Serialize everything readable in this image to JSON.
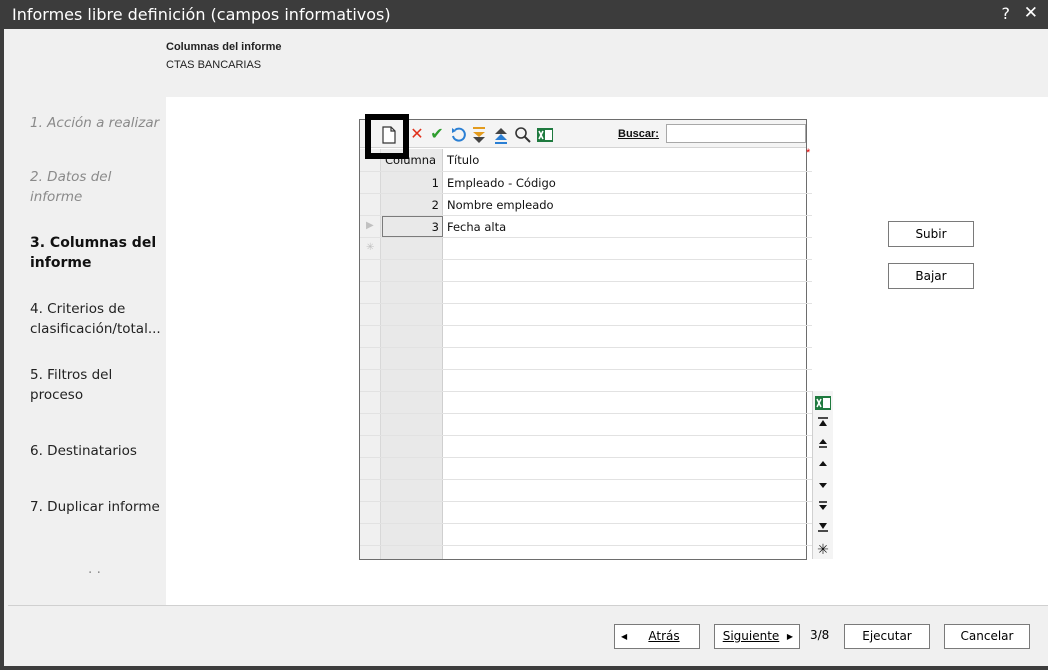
{
  "window": {
    "title": "Informes libre definición (campos informativos)",
    "help": "?",
    "close": "✕"
  },
  "header": {
    "title": "Columnas del informe",
    "subtitle": "CTAS BANCARIAS"
  },
  "sidebar": {
    "steps": [
      {
        "label": "1. Acción a realizar",
        "state": "done"
      },
      {
        "label": "2. Datos del informe",
        "state": "done"
      },
      {
        "label": "3. Columnas del informe",
        "state": "active"
      },
      {
        "label": "4. Criterios de clasificación/total...",
        "state": "pending"
      },
      {
        "label": "5. Filtros del proceso",
        "state": "pending"
      },
      {
        "label": "6. Destinatarios",
        "state": "pending"
      },
      {
        "label": "7. Duplicar informe",
        "state": "pending"
      },
      {
        "label": "· ·",
        "state": "pending"
      }
    ]
  },
  "toolbar": {
    "icons": [
      "new-icon",
      "delete-icon",
      "accept-icon",
      "undo-icon",
      "move-down-icon",
      "move-up-icon",
      "search-icon",
      "excel-icon"
    ],
    "search_label": "Buscar:",
    "search_value": ""
  },
  "grid": {
    "headers": {
      "column": "Columna",
      "title": "Título"
    },
    "required_mark": "*",
    "rows": [
      {
        "num": "1",
        "title": "Empleado -  Código"
      },
      {
        "num": "2",
        "title": "Nombre empleado"
      },
      {
        "num": "3",
        "title": "Fecha alta"
      }
    ],
    "current_marker": "▶",
    "new_marker": "✳"
  },
  "side_buttons": {
    "up": "Subir",
    "down": "Bajar"
  },
  "nav": {
    "excel": "X",
    "first": "⏫",
    "prev_page": "⏶",
    "prev": "▲",
    "next": "▼",
    "next_page": "⏷",
    "last": "⏬",
    "new": "✳"
  },
  "footer": {
    "back": "Atrás",
    "next": "Siguiente",
    "step_count": "3/8",
    "run": "Ejecutar",
    "cancel": "Cancelar"
  },
  "colors": {
    "titlebar": "#3c3c3c",
    "delete": "#e0311b",
    "accept": "#2e9e2e",
    "undo": "#2a7fd4",
    "excel": "#1f7a3f",
    "highlight": "#000000"
  }
}
